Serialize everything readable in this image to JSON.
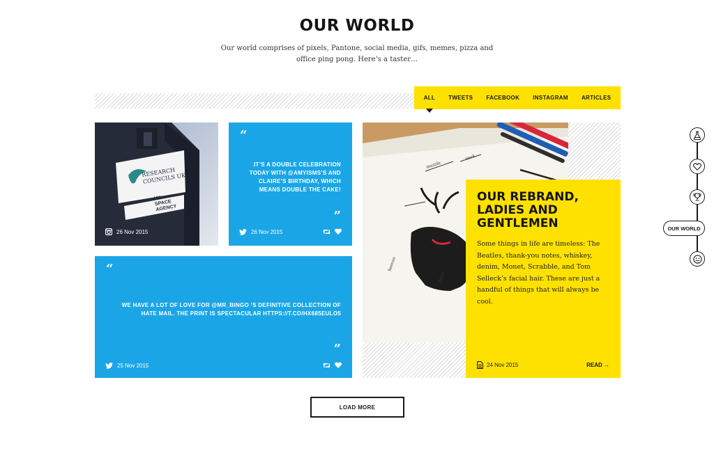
{
  "header": {
    "title": "OUR WORLD",
    "subtitle": "Our world comprises of pixels, Pantone, social media, gifs, memes, pizza and office ping pong. Here’s a taster…"
  },
  "filters": {
    "tabs": [
      {
        "label": "ALL",
        "active": true
      },
      {
        "label": "TWEETS",
        "active": false
      },
      {
        "label": "FACEBOOK",
        "active": false
      },
      {
        "label": "INSTAGRAM",
        "active": false
      },
      {
        "label": "ARTICLES",
        "active": false
      }
    ]
  },
  "cards": {
    "instagram": {
      "date": "26 Nov 2015",
      "icon": "instagram-icon",
      "sign_lines": [
        "RESEARCH",
        "COUNCILS UK"
      ],
      "sign_sub": [
        "UK",
        "SPACE",
        "AGENCY"
      ]
    },
    "tweet1": {
      "text": "IT’S A DOUBLE CELEBRATION TODAY WITH @AMYISMS’S AND CLAIRE’S BIRTHDAY, WHICH MEANS DOUBLE THE CAKE!",
      "date": "26 Nov 2015",
      "icon": "twitter-icon"
    },
    "tweet2": {
      "text": "WE HAVE A LOT OF LOVE FOR @MR_BINGO ‘S DEFINITIVE COLLECTION OF HATE MAIL. THE PRINT IS SPECTACULAR HTTPS://T.CO/HX685EULO5",
      "date": "25 Nov 2015",
      "icon": "twitter-icon"
    },
    "article": {
      "title": "OUR REBRAND, LADIES AND GENTLEMEN",
      "body": "Some things in life are timeless: The Beatles, thank-you notes, whiskey, denim, Monet, Scrabble, and Tom Selleck’s facial hair. These are just a handful of things that will always be cool.",
      "date": "24 Nov 2015",
      "read_label": "READ →",
      "icon": "document-icon"
    }
  },
  "load_more_label": "LOAD MORE",
  "side_nav": {
    "active_label": "OUR WORLD",
    "icons": [
      "flask-icon",
      "heart-icon",
      "trophy-icon",
      "smiley-icon"
    ]
  },
  "colors": {
    "accent_yellow": "#ffe100",
    "twitter_blue": "#1aa6e6",
    "ink": "#1a1a1a"
  }
}
